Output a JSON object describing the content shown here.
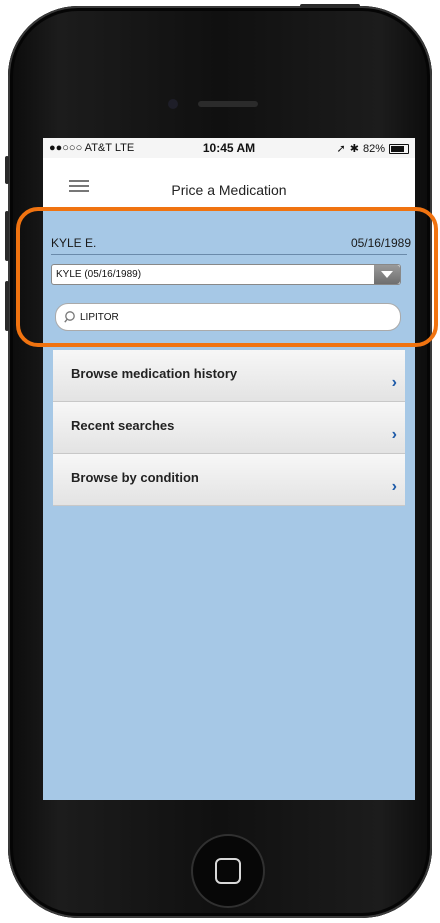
{
  "status_bar": {
    "carrier": "●●○○○ AT&T  LTE",
    "time": "10:45 AM",
    "battery": "82%"
  },
  "nav": {
    "title": "Price a Medication"
  },
  "patient": {
    "name": "KYLE E.",
    "dob": "05/16/1989"
  },
  "patient_select": {
    "value": "KYLE (05/16/1989)"
  },
  "search": {
    "value": "LIPITOR"
  },
  "menu": [
    {
      "label": "Browse medication history"
    },
    {
      "label": "Recent searches"
    },
    {
      "label": "Browse by condition"
    }
  ],
  "colors": {
    "screen_bg": "#a6c8e6",
    "highlight": "#f07310",
    "chevron": "#1d5aa8"
  }
}
